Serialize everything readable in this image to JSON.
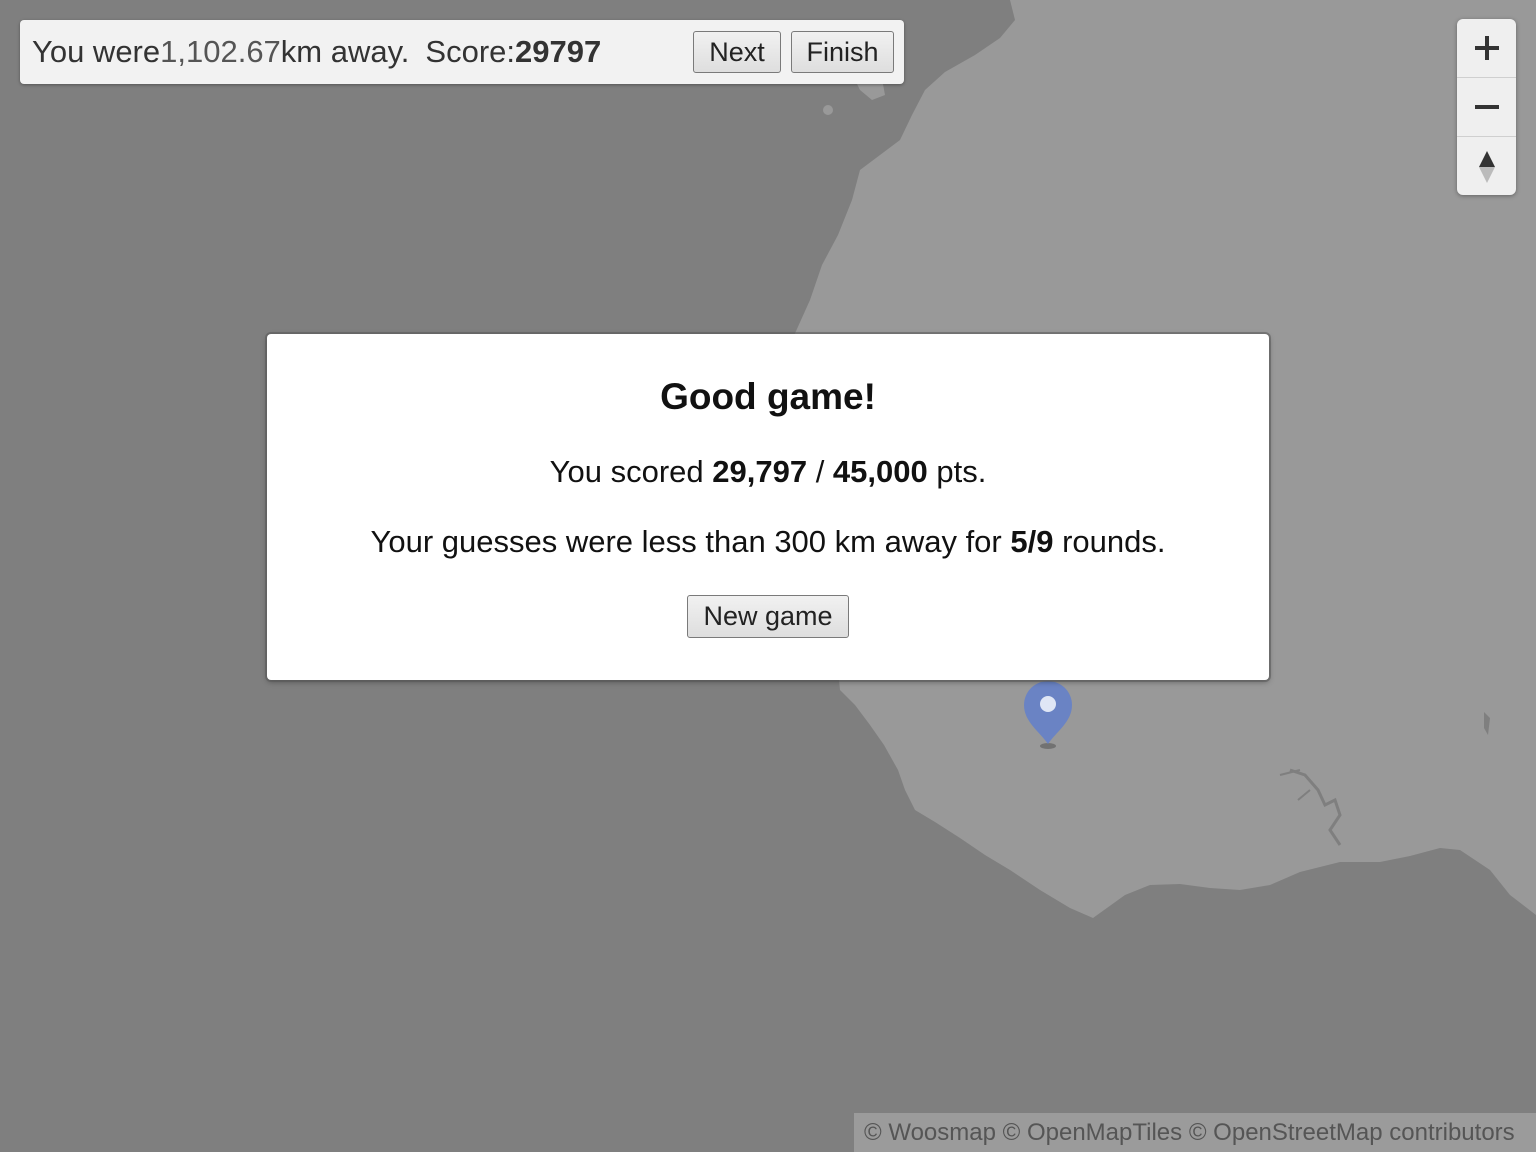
{
  "result_bar": {
    "prefix": "You were ",
    "distance": "1,102.67",
    "suffix": " km away.",
    "score_label": "Score: ",
    "score_value": "29797",
    "next_label": "Next",
    "finish_label": "Finish"
  },
  "zoom": {
    "zoom_in_icon": "plus-icon",
    "zoom_out_icon": "minus-icon",
    "compass_icon": "compass-icon"
  },
  "modal": {
    "title": "Good game!",
    "score_prefix": "You scored ",
    "score_value": "29,797",
    "score_sep": " / ",
    "score_max": "45,000",
    "score_suffix": " pts.",
    "rounds_prefix": "Your guesses were less than 300 km away for ",
    "rounds_value": "5/9",
    "rounds_suffix": " rounds.",
    "new_game_label": "New game"
  },
  "map": {
    "water_color": "#7f7f7f",
    "land_color": "#999999",
    "marker_color": "#6a83c4",
    "marker_icon": "map-pin-icon"
  },
  "attribution": {
    "text": "© Woosmap © OpenMapTiles © OpenStreetMap contributors"
  }
}
